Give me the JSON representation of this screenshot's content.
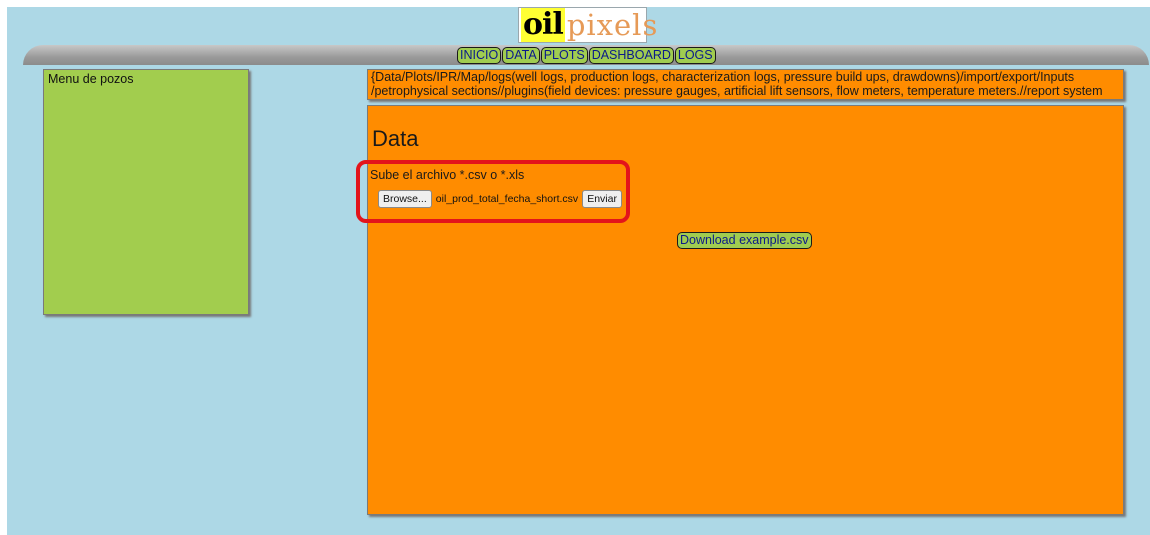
{
  "logo": {
    "part1": "oil",
    "part2": "pixels"
  },
  "nav": {
    "items": [
      "INICIO",
      "DATA",
      "PLOTS",
      "DASHBOARD",
      "LOGS"
    ]
  },
  "sidebar": {
    "title": "Menu de pozos"
  },
  "description": "{Data/Plots/IPR/Map/logs(well logs, production logs, characterization logs, pressure build ups, drawdowns)/import/export/Inputs /petrophysical sections//plugins(field devices: pressure gauges, artificial lift sensors, flow meters, temperature meters.//report system (file creation)}",
  "main": {
    "heading": "Data",
    "upload_label": "Sube el archivo *.csv o *.xls",
    "browse_label": "Browse...",
    "file_name": "oil_prod_total_fecha_short.csv",
    "submit_label": "Enviar",
    "download_label": "Download example.csv"
  },
  "colors": {
    "page_bg": "#add8e6",
    "accent_green": "#a0cc50",
    "panel_orange": "#ff8c00",
    "highlight_red": "#e3141b"
  }
}
